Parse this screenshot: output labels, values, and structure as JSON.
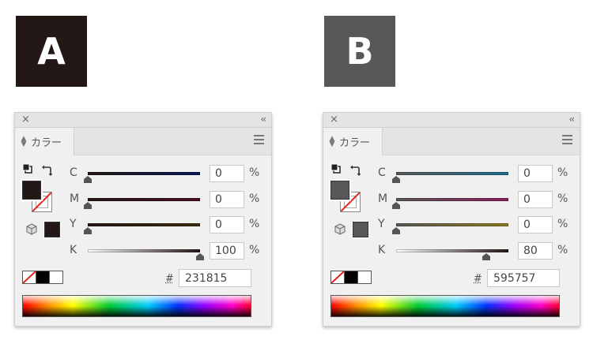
{
  "panels": [
    {
      "badge": {
        "letter": "A",
        "color": "#231815"
      },
      "title_close": "×",
      "title_collapse": "‹‹",
      "tab_label": "カラー",
      "fill_color": "#231815",
      "gamut_color": "#231815",
      "sliders": [
        {
          "label": "C",
          "value": "0",
          "unit": "%",
          "level": 0,
          "track": [
            "#231815",
            "#0a1a55"
          ]
        },
        {
          "label": "M",
          "value": "0",
          "unit": "%",
          "level": 0,
          "track": [
            "#231815",
            "#4a0d28"
          ]
        },
        {
          "label": "Y",
          "value": "0",
          "unit": "%",
          "level": 0,
          "track": [
            "#231815",
            "#3a2c0c"
          ]
        },
        {
          "label": "K",
          "value": "100",
          "unit": "%",
          "level": 1.0,
          "track": [
            "#ffffff",
            "#231815"
          ]
        }
      ],
      "hash_label": "#",
      "hex": "231815"
    },
    {
      "badge": {
        "letter": "B",
        "color": "#595757"
      },
      "title_close": "×",
      "title_collapse": "‹‹",
      "tab_label": "カラー",
      "fill_color": "#595757",
      "gamut_color": "#595757",
      "sliders": [
        {
          "label": "C",
          "value": "0",
          "unit": "%",
          "level": 0,
          "track": [
            "#595757",
            "#1f6f8f"
          ]
        },
        {
          "label": "M",
          "value": "0",
          "unit": "%",
          "level": 0,
          "track": [
            "#595757",
            "#8a1f5a"
          ]
        },
        {
          "label": "Y",
          "value": "0",
          "unit": "%",
          "level": 0,
          "track": [
            "#595757",
            "#8a7a1c"
          ]
        },
        {
          "label": "K",
          "value": "80",
          "unit": "%",
          "level": 0.8,
          "track": [
            "#ffffff",
            "#231815"
          ]
        }
      ],
      "hash_label": "#",
      "hex": "595757"
    }
  ]
}
